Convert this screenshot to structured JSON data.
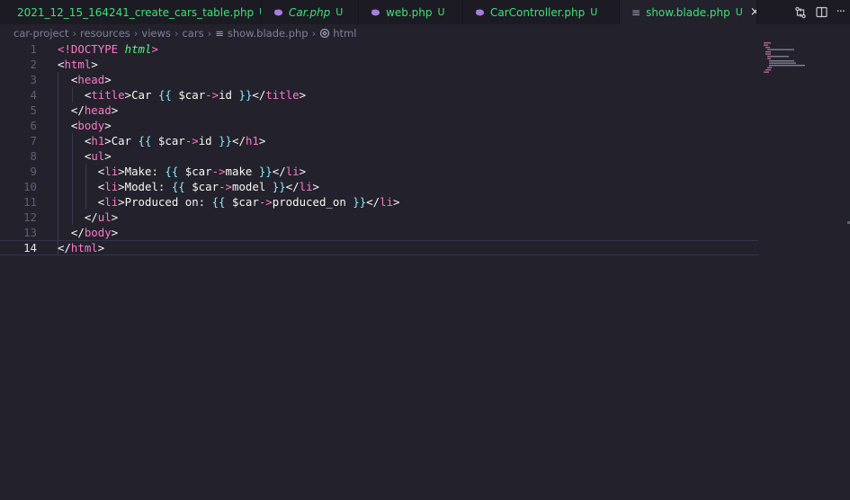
{
  "tabs": [
    {
      "name": "2021_12_15_164241_create_cars_table.php",
      "status": "U",
      "italic": false,
      "active": false
    },
    {
      "name": "Car.php",
      "status": "U",
      "italic": true,
      "active": false
    },
    {
      "name": "web.php",
      "status": "U",
      "italic": false,
      "active": false
    },
    {
      "name": "CarController.php",
      "status": "U",
      "italic": false,
      "active": false
    },
    {
      "name": "show.blade.php",
      "status": "U",
      "italic": false,
      "active": true
    }
  ],
  "tab_close_glyph": "×",
  "tab_actions": {
    "compare_icon": "git-compare-icon",
    "split_icon": "split-editor-icon",
    "more_icon": "more-actions-icon"
  },
  "breadcrumb": {
    "items": [
      "car-project",
      "resources",
      "views",
      "cars"
    ],
    "file": "show.blade.php",
    "symbol": "html"
  },
  "editor": {
    "current_line": 14,
    "lines": [
      {
        "n": "1"
      },
      {
        "n": "2"
      },
      {
        "n": "3"
      },
      {
        "n": "4"
      },
      {
        "n": "5"
      },
      {
        "n": "6"
      },
      {
        "n": "7"
      },
      {
        "n": "8"
      },
      {
        "n": "9"
      },
      {
        "n": "10"
      },
      {
        "n": "11"
      },
      {
        "n": "12"
      },
      {
        "n": "13"
      },
      {
        "n": "14"
      }
    ],
    "tokens": {
      "l1_a": "<!DOCTYPE",
      "l1_b": "html",
      "l1_c": ">",
      "l2_a": "<",
      "l2_b": "html",
      "l2_c": ">",
      "l3_a": "<",
      "l3_b": "head",
      "l3_c": ">",
      "l4_a": "<",
      "l4_b": "title",
      "l4_c": ">Car ",
      "l4_d": "{{",
      "l4_e": " $car",
      "l4_f": "->",
      "l4_g": "id ",
      "l4_h": "}}",
      "l4_i": "</",
      "l4_j": "title",
      "l4_k": ">",
      "l5_a": "</",
      "l5_b": "head",
      "l5_c": ">",
      "l6_a": "<",
      "l6_b": "body",
      "l6_c": ">",
      "l7_a": "<",
      "l7_b": "h1",
      "l7_c": ">Car ",
      "l7_d": "{{",
      "l7_e": " $car",
      "l7_f": "->",
      "l7_g": "id ",
      "l7_h": "}}",
      "l7_i": "</",
      "l7_j": "h1",
      "l7_k": ">",
      "l8_a": "<",
      "l8_b": "ul",
      "l8_c": ">",
      "l9_a": "<",
      "l9_b": "li",
      "l9_c": ">Make: ",
      "l9_d": "{{",
      "l9_e": " $car",
      "l9_f": "->",
      "l9_g": "make ",
      "l9_h": "}}",
      "l9_i": "</",
      "l9_j": "li",
      "l9_k": ">",
      "l10_a": "<",
      "l10_b": "li",
      "l10_c": ">Model: ",
      "l10_d": "{{",
      "l10_e": " $car",
      "l10_f": "->",
      "l10_g": "model ",
      "l10_h": "}}",
      "l10_i": "</",
      "l10_j": "li",
      "l10_k": ">",
      "l11_a": "<",
      "l11_b": "li",
      "l11_c": ">Produced on: ",
      "l11_d": "{{",
      "l11_e": " $car",
      "l11_f": "->",
      "l11_g": "produced_on ",
      "l11_h": "}}",
      "l11_i": "</",
      "l11_j": "li",
      "l11_k": ">",
      "l12_a": "</",
      "l12_b": "ul",
      "l12_c": ">",
      "l13_a": "</",
      "l13_b": "body",
      "l13_c": ">",
      "l14_a": "</",
      "l14_b": "html",
      "l14_c": ">"
    }
  },
  "colors": {
    "tab_text": "#3fe07a",
    "tag": "#ff79c6",
    "text": "#f8f8f2",
    "string": "#50fa7b",
    "blade": "#8be9fd",
    "php_icon": "#a27fe0"
  }
}
